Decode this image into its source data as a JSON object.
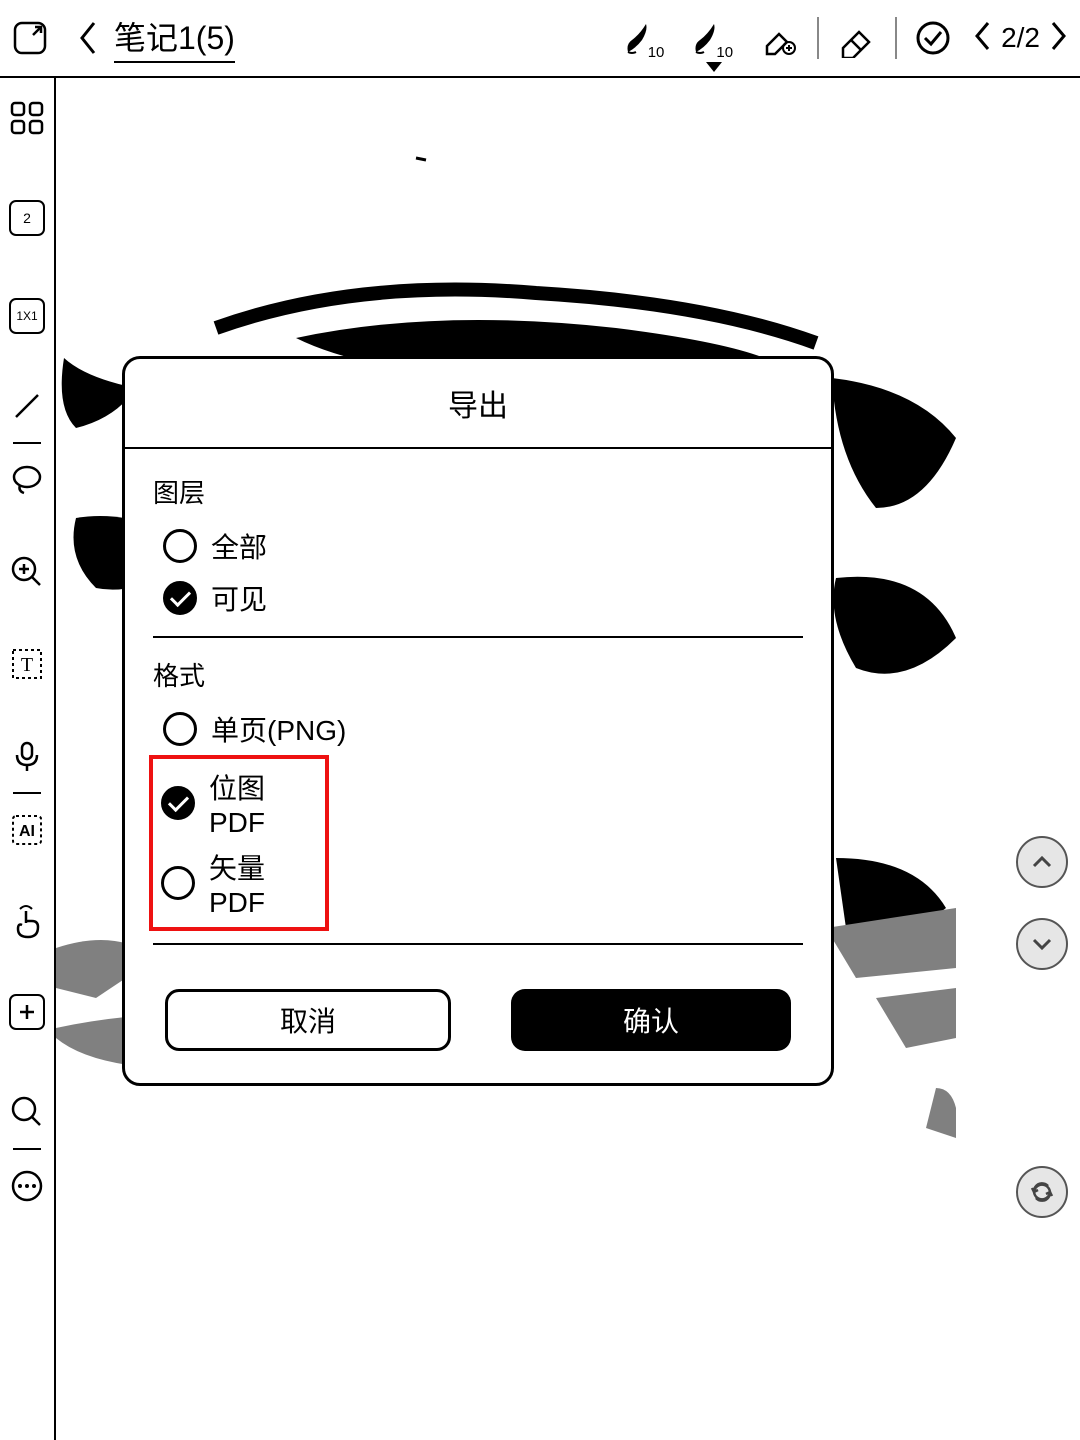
{
  "header": {
    "title": "笔记1(5)",
    "brush1_size": "10",
    "brush2_size": "10",
    "page_indicator": "2/2"
  },
  "sidebar": {
    "layer_badge": "2",
    "ratio_badge": "1X1",
    "ai_label": "AI"
  },
  "dialog": {
    "title": "导出",
    "section_layer": "图层",
    "layer_opt_all": "全部",
    "layer_opt_visible": "可见",
    "section_format": "格式",
    "format_opt_png": "单页(PNG)",
    "format_opt_bitmap": "位图PDF",
    "format_opt_vector": "矢量PDF",
    "cancel": "取消",
    "confirm": "确认"
  }
}
